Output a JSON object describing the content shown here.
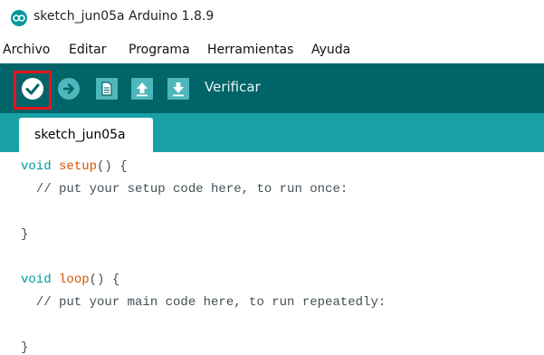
{
  "window": {
    "title": "sketch_jun05a Arduino 1.8.9"
  },
  "menu": {
    "items": [
      "Archivo",
      "Editar",
      "Programa",
      "Herramientas",
      "Ayuda"
    ]
  },
  "toolbar": {
    "buttons": [
      {
        "name": "verify",
        "icon": "checkmark-icon"
      },
      {
        "name": "upload",
        "icon": "arrow-right-icon"
      },
      {
        "name": "new",
        "icon": "document-icon"
      },
      {
        "name": "open",
        "icon": "arrow-up-icon"
      },
      {
        "name": "save",
        "icon": "arrow-down-icon"
      }
    ],
    "status_label": "Verificar",
    "highlighted_button": "verify",
    "highlight_color": "#e8141c",
    "background_color": "#006468"
  },
  "tabs": {
    "active": "sketch_jun05a"
  },
  "editor": {
    "lines": {
      "l1_kw": "void",
      "l1_fn": "setup",
      "l1_rest": "() {",
      "l2": "  // put your setup code here, to run once:",
      "l3": "",
      "l4": "}",
      "l5": "",
      "l6_kw": "void",
      "l6_fn": "loop",
      "l6_rest": "() {",
      "l7": "  // put your main code here, to run repeatedly:",
      "l8": "",
      "l9": "}"
    },
    "keyword_color": "#00979c",
    "function_color": "#d35400"
  }
}
